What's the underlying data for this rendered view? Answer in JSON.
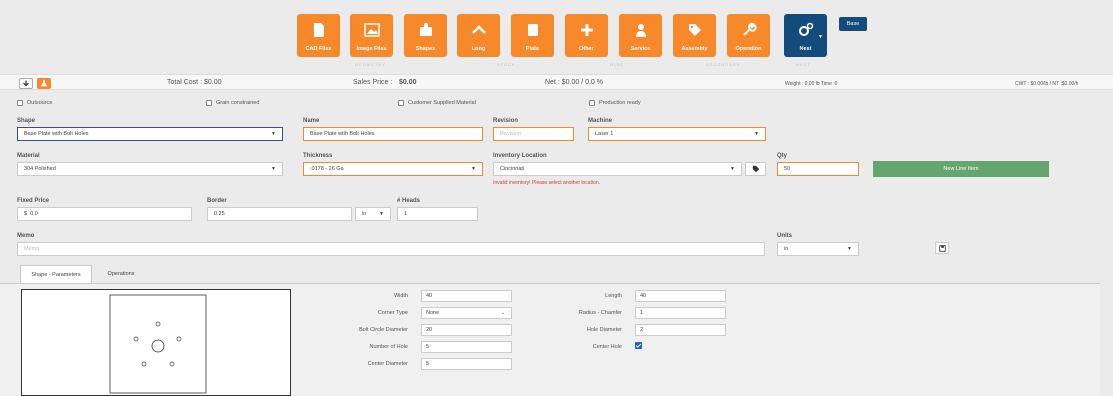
{
  "toolbar": {
    "buttons": [
      {
        "id": "cad",
        "label": "CAD Files",
        "icon": "file-icon"
      },
      {
        "id": "image",
        "label": "Image Files",
        "icon": "image-icon"
      },
      {
        "id": "shapes",
        "label": "Shapes",
        "icon": "puzzle-icon"
      },
      {
        "id": "long",
        "label": "Long",
        "icon": "chevron-up-icon"
      },
      {
        "id": "plate",
        "label": "Plate",
        "icon": "square-icon"
      },
      {
        "id": "other",
        "label": "Other",
        "icon": "plus-icon"
      },
      {
        "id": "service",
        "label": "Service",
        "icon": "person-icon"
      },
      {
        "id": "assembly",
        "label": "Assembly",
        "icon": "tag-icon"
      },
      {
        "id": "operation",
        "label": "Operation",
        "icon": "wrench-icon"
      },
      {
        "id": "nest",
        "label": "Nest",
        "icon": "gears-icon"
      }
    ],
    "groups": [
      "GEOMETRY",
      "STOCK",
      "MISC",
      "SECONDARY",
      "NEST"
    ],
    "base_label": "Base"
  },
  "summary": {
    "total_cost": "Total Cost : $0.00",
    "sales_price_label": "Sales Price : ",
    "sales_price_value": "$0.00",
    "net": "Net : $0.00 / 0.0 %",
    "weight": "Weight : 0.00 lb Time :0",
    "cwt": "CWT : $0.00/lb / NT :$0.00/h"
  },
  "form": {
    "checkboxes": {
      "outsource": "Outsource",
      "grain": "Grain constrained",
      "customer_material": "Customer Supplied Material",
      "production_ready": "Production ready"
    },
    "shape": {
      "label": "Shape",
      "value": "Base Plate with Bolt Holes"
    },
    "name": {
      "label": "Name",
      "value": "Base Plate with Bolt Holes"
    },
    "revision": {
      "label": "Revision",
      "placeholder": "Revision"
    },
    "machine": {
      "label": "Machine",
      "value": "Laser 1"
    },
    "material": {
      "label": "Material",
      "value": "304 Polished"
    },
    "thickness": {
      "label": "Thickness",
      "value": ".0178 - 26 Ga"
    },
    "inventory": {
      "label": "Inventory Location",
      "value": "Cincinnati",
      "error": "Invalid inventory! Please select another location."
    },
    "qty": {
      "label": "Qty",
      "value": "50"
    },
    "new_line_item": "New Line Item",
    "fixed_price": {
      "label": "Fixed Price",
      "prefix": "$",
      "value": "0.0"
    },
    "border": {
      "label": "Border",
      "value": "0.25",
      "unit": "in"
    },
    "heads": {
      "label": "# Heads",
      "value": "1"
    },
    "memo": {
      "label": "Memo",
      "placeholder": "Memo"
    },
    "units": {
      "label": "Units",
      "value": "in"
    }
  },
  "tabs": [
    "Shape - Parameters",
    "Operations"
  ],
  "params": {
    "width": {
      "label": "Width",
      "value": "40"
    },
    "corner_type": {
      "label": "Corner Type",
      "value": "None"
    },
    "bolt_circle": {
      "label": "Bolt Circle Diameter",
      "value": "20"
    },
    "num_holes": {
      "label": "Number of Hole",
      "value": "5"
    },
    "center_diam": {
      "label": "Center Diameter",
      "value": "5"
    },
    "length": {
      "label": "Length",
      "value": "40"
    },
    "radius": {
      "label": "Radius - Chamfer",
      "value": "1"
    },
    "hole_diam": {
      "label": "Hole Diameter",
      "value": "2"
    },
    "center_hole": {
      "label": "Center Hole",
      "checked": true
    }
  }
}
